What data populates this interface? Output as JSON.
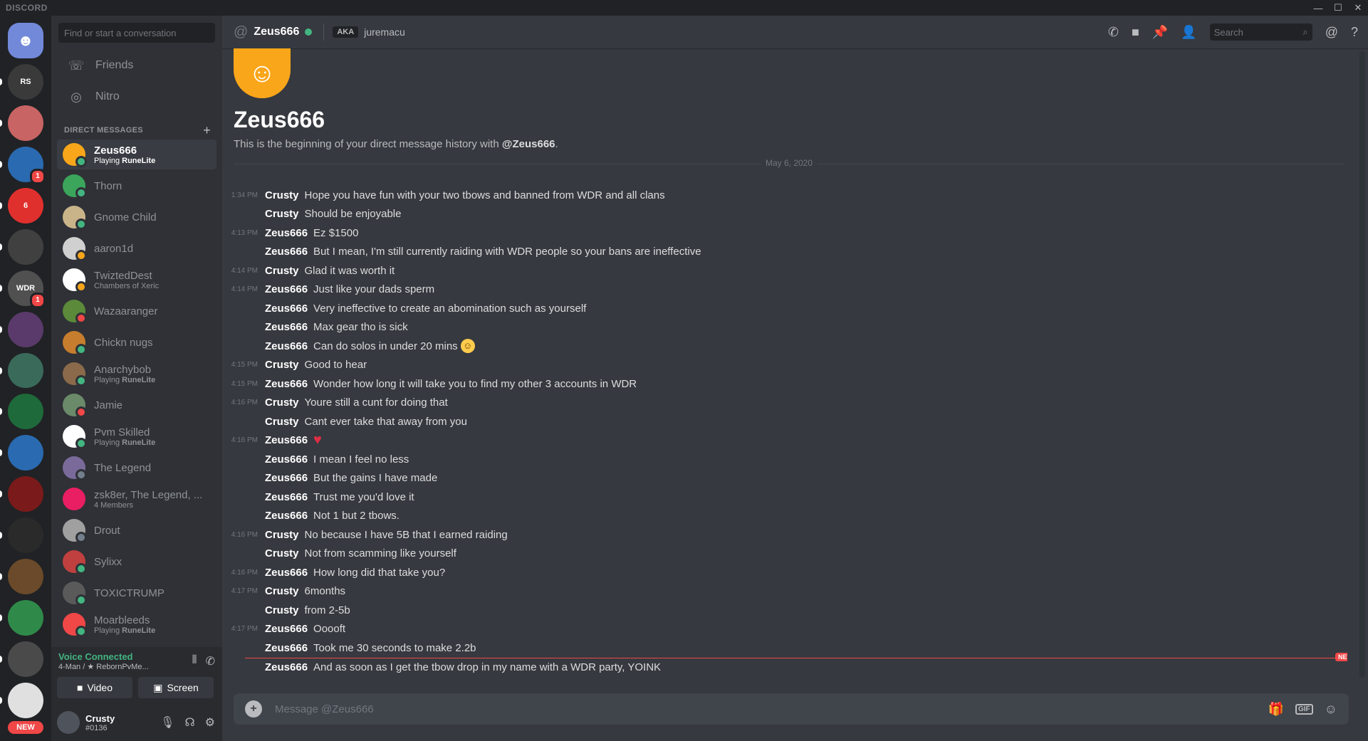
{
  "titlebar": {
    "brand": "DISCORD"
  },
  "servers": [
    {
      "label": "",
      "badge": ""
    },
    {
      "label": "RS",
      "badge": ""
    },
    {
      "label": "",
      "badge": ""
    },
    {
      "label": "",
      "badge": "1"
    },
    {
      "label": "6",
      "badge": ""
    },
    {
      "label": "",
      "badge": ""
    },
    {
      "label": "WDR",
      "badge": "1"
    },
    {
      "label": "",
      "badge": ""
    },
    {
      "label": "",
      "badge": ""
    },
    {
      "label": "",
      "badge": ""
    },
    {
      "label": "",
      "badge": ""
    },
    {
      "label": "",
      "badge": ""
    },
    {
      "label": "",
      "badge": ""
    },
    {
      "label": "",
      "badge": ""
    },
    {
      "label": "",
      "badge": ""
    },
    {
      "label": "",
      "badge": ""
    },
    {
      "label": "",
      "badge": ""
    }
  ],
  "new_label": "NEW",
  "sidebar": {
    "search_placeholder": "Find or start a conversation",
    "nav": [
      {
        "label": "Friends"
      },
      {
        "label": "Nitro"
      }
    ],
    "dm_header": "DIRECT MESSAGES",
    "dms": [
      {
        "name": "Zeus666",
        "sub_prefix": "Playing ",
        "sub_bold": "RuneLite",
        "status": "online",
        "color": "#faa61a"
      },
      {
        "name": "Thorn",
        "sub_prefix": "",
        "sub_bold": "",
        "status": "online",
        "color": "#3ba55c"
      },
      {
        "name": "Gnome Child",
        "sub_prefix": "",
        "sub_bold": "",
        "status": "online",
        "color": "#c9b48a"
      },
      {
        "name": "aaron1d",
        "sub_prefix": "",
        "sub_bold": "",
        "status": "idle",
        "color": "#d0d0d0"
      },
      {
        "name": "TwiztedDest",
        "sub_prefix": "Chambers of Xeric",
        "sub_bold": "",
        "status": "idle",
        "color": "#ffffff"
      },
      {
        "name": "Wazaaranger",
        "sub_prefix": "",
        "sub_bold": "",
        "status": "dnd",
        "color": "#5a8a3a"
      },
      {
        "name": "Chickn nugs",
        "sub_prefix": "",
        "sub_bold": "",
        "status": "online",
        "color": "#c77d2e"
      },
      {
        "name": "Anarchybob",
        "sub_prefix": "Playing ",
        "sub_bold": "RuneLite",
        "status": "online",
        "color": "#8a6a4a"
      },
      {
        "name": "Jamie",
        "sub_prefix": "",
        "sub_bold": "",
        "status": "dnd",
        "color": "#6a8a6a"
      },
      {
        "name": "Pvm Skilled",
        "sub_prefix": "Playing ",
        "sub_bold": "RuneLite",
        "status": "online",
        "color": "#ffffff"
      },
      {
        "name": "The Legend",
        "sub_prefix": "",
        "sub_bold": "",
        "status": "offline",
        "color": "#7a6a9a"
      },
      {
        "name": "zsk8er, The Legend, ...",
        "sub_prefix": "4 Members",
        "sub_bold": "",
        "status": "",
        "color": "#e91e63"
      },
      {
        "name": "Drout",
        "sub_prefix": "",
        "sub_bold": "",
        "status": "offline",
        "color": "#a0a0a0"
      },
      {
        "name": "Sylixx",
        "sub_prefix": "",
        "sub_bold": "",
        "status": "online",
        "color": "#c04040"
      },
      {
        "name": "TOXICTRUMP",
        "sub_prefix": "",
        "sub_bold": "",
        "status": "online",
        "color": "#5a5a5a"
      },
      {
        "name": "Moarbleeds",
        "sub_prefix": "Playing ",
        "sub_bold": "RuneLite",
        "status": "online",
        "color": "#f04747"
      }
    ],
    "voice": {
      "status": "Voice Connected",
      "channel": "4-Man / ★ RebornPvMe...",
      "video_label": "Video",
      "screen_label": "Screen"
    },
    "user": {
      "name": "Crusty",
      "tag": "#0136"
    }
  },
  "header": {
    "title": "Zeus666",
    "aka_label": "AKA",
    "aka_name": "juremacu",
    "search_placeholder": "Search"
  },
  "intro": {
    "title": "Zeus666",
    "sub_prefix": "This is the beginning of your direct message history with ",
    "sub_user": "@Zeus666",
    "sub_suffix": ".",
    "date": "May 6, 2020"
  },
  "messages": [
    {
      "ts": "1:34 PM",
      "author": "Crusty",
      "text": "Hope you have fun with your two tbows and banned from WDR and all clans"
    },
    {
      "ts": "",
      "author": "Crusty",
      "text": "Should be enjoyable"
    },
    {
      "ts": "4:13 PM",
      "author": "Zeus666",
      "text": "Ez $1500"
    },
    {
      "ts": "",
      "author": "Zeus666",
      "text": "But I mean, I'm still currently raiding with WDR people so your bans are ineffective"
    },
    {
      "ts": "4:14 PM",
      "author": "Crusty",
      "text": "Glad it was worth it"
    },
    {
      "ts": "4:14 PM",
      "author": "Zeus666",
      "text": "Just like your dads sperm"
    },
    {
      "ts": "",
      "author": "Zeus666",
      "text": "Very ineffective to create an abomination such as yourself"
    },
    {
      "ts": "",
      "author": "Zeus666",
      "text": "Max gear tho is sick"
    },
    {
      "ts": "",
      "author": "Zeus666",
      "text": "Can do solos in under 20 mins",
      "emoji": "smile"
    },
    {
      "ts": "4:15 PM",
      "author": "Crusty",
      "text": "Good to hear"
    },
    {
      "ts": "4:15 PM",
      "author": "Zeus666",
      "text": "Wonder how long it will take you to find my other 3 accounts in WDR"
    },
    {
      "ts": "4:16 PM",
      "author": "Crusty",
      "text": "Youre still a cunt for doing that"
    },
    {
      "ts": "",
      "author": "Crusty",
      "text": "Cant ever take that away from you"
    },
    {
      "ts": "4:16 PM",
      "author": "Zeus666",
      "text": "",
      "emoji": "heart"
    },
    {
      "ts": "",
      "author": "Zeus666",
      "text": "I mean I feel no less"
    },
    {
      "ts": "",
      "author": "Zeus666",
      "text": "But the gains I have made"
    },
    {
      "ts": "",
      "author": "Zeus666",
      "text": "Trust me you'd love it"
    },
    {
      "ts": "",
      "author": "Zeus666",
      "text": "Not 1 but 2 tbows."
    },
    {
      "ts": "4:16 PM",
      "author": "Crusty",
      "text": "No because I have 5B that I earned raiding"
    },
    {
      "ts": "",
      "author": "Crusty",
      "text": "Not from scamming like yourself"
    },
    {
      "ts": "4:16 PM",
      "author": "Zeus666",
      "text": "How long did that take you?"
    },
    {
      "ts": "4:17 PM",
      "author": "Crusty",
      "text": "6months"
    },
    {
      "ts": "",
      "author": "Crusty",
      "text": "from 2-5b"
    },
    {
      "ts": "4:17 PM",
      "author": "Zeus666",
      "text": "Ooooft"
    },
    {
      "ts": "",
      "author": "Zeus666",
      "text": "Took me 30 seconds to make 2.2b"
    },
    {
      "ts": "",
      "author": "Zeus666",
      "text": "And as soon as I get the tbow drop in my name with a WDR party, YOINK"
    }
  ],
  "new_marker": "NEW",
  "composer": {
    "placeholder": "Message @Zeus666",
    "gif_label": "GIF"
  },
  "colors": {
    "accent": "#7289da",
    "online": "#43b581",
    "dnd": "#f04747",
    "idle": "#faa61a"
  }
}
